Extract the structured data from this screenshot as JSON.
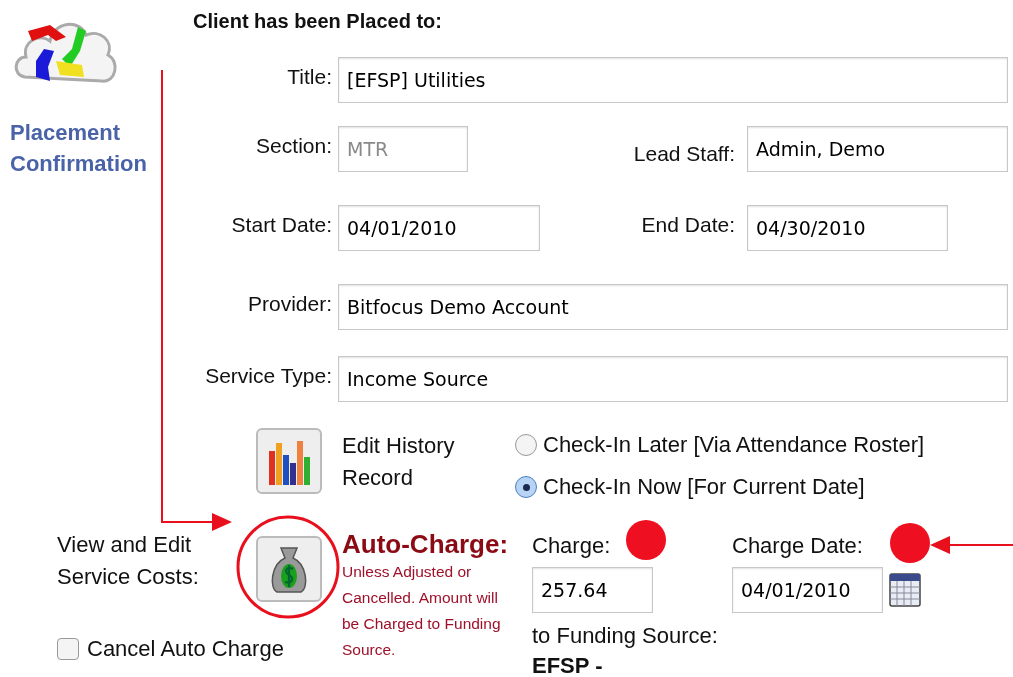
{
  "logo": {
    "caption": "Placement Confirmation"
  },
  "heading": "Client has been Placed to:",
  "title": {
    "label": "Title:",
    "value": "[EFSP] Utilities"
  },
  "section": {
    "label": "Section:",
    "value": "MTR",
    "disabled": true
  },
  "lead_staff": {
    "label": "Lead Staff:",
    "value": "Admin, Demo"
  },
  "start_date": {
    "label": "Start Date:",
    "value": "04/01/2010"
  },
  "end_date": {
    "label": "End Date:",
    "value": "04/30/2010"
  },
  "provider": {
    "label": "Provider:",
    "value": "Bitfocus Demo Account"
  },
  "service_type": {
    "label": "Service Type:",
    "value": "Income Source"
  },
  "history": {
    "label": "Edit History Record"
  },
  "check_in": [
    {
      "label": "Check-In Later [Via Attendance Roster]",
      "selected": false
    },
    {
      "label": "Check-In Now [For Current Date]",
      "selected": true
    }
  ],
  "service_costs": {
    "label": "View and Edit Service Costs:"
  },
  "auto_charge": {
    "title": "Auto-Charge:",
    "note": "Unless Adjusted or Cancelled. Amount will be Charged to Funding Source."
  },
  "charge": {
    "label": "Charge:",
    "value": "257.64"
  },
  "charge_date": {
    "label": "Charge Date:",
    "value": "04/01/2010"
  },
  "funding_source": {
    "label": "to Funding Source:",
    "value": "EFSP -"
  },
  "cancel_auto_charge": {
    "label": "Cancel Auto Charge",
    "checked": false
  }
}
